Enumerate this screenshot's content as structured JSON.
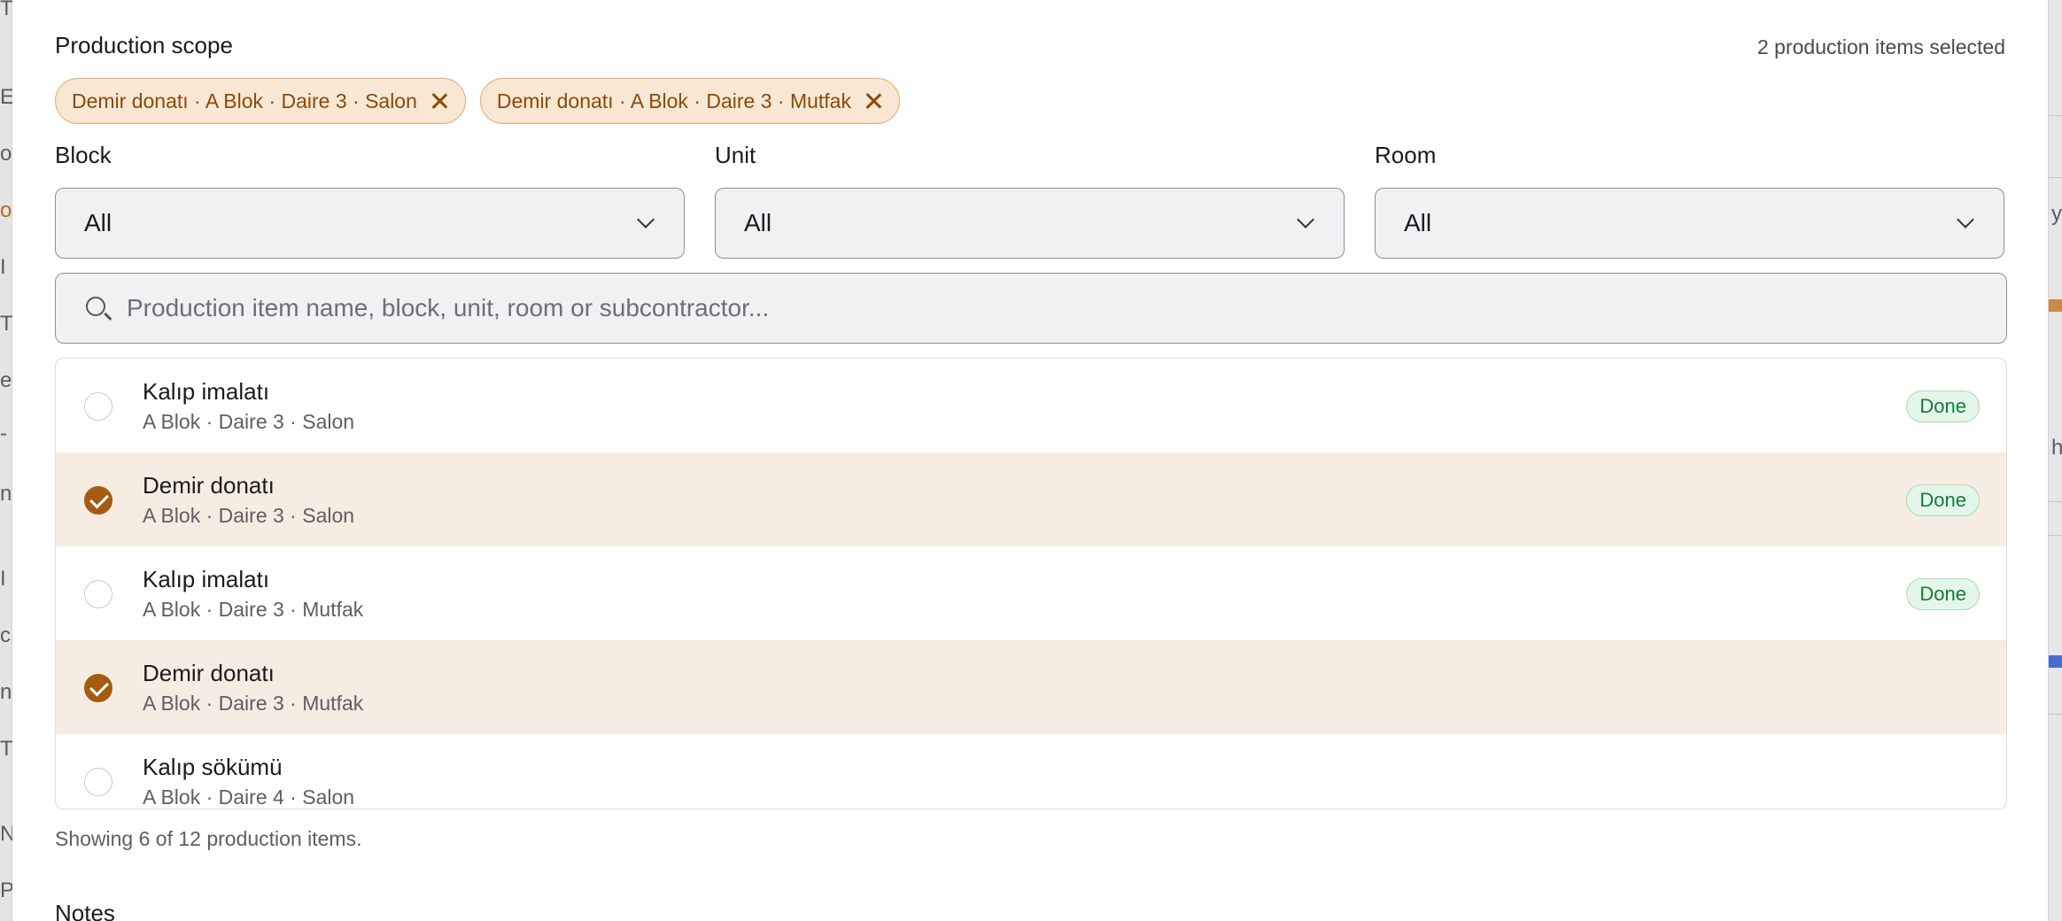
{
  "background": {
    "left_fragments": [
      "TI",
      "E",
      "or",
      "or",
      "I",
      "T",
      "et",
      "-",
      "nt",
      "I",
      "c",
      "n",
      "T",
      "N",
      "P"
    ],
    "right_fragments": [
      "y",
      "hi"
    ]
  },
  "production_scope": {
    "label": "Production scope",
    "selected_count_text": "2 production items selected",
    "chips": [
      {
        "label": "Demir donatı · A Blok · Daire 3 · Salon"
      },
      {
        "label": "Demir donatı · A Blok · Daire 3 · Mutfak"
      }
    ]
  },
  "filters": {
    "block": {
      "label": "Block",
      "value": "All"
    },
    "unit": {
      "label": "Unit",
      "value": "All"
    },
    "room": {
      "label": "Room",
      "value": "All"
    }
  },
  "search": {
    "placeholder": "Production item name, block, unit, room or subcontractor...",
    "value": ""
  },
  "items": [
    {
      "title": "Kalıp imalatı",
      "location": "A Blok · Daire 3 · Salon",
      "status": "Done",
      "selected": false
    },
    {
      "title": "Demir donatı",
      "location": "A Blok · Daire 3 · Salon",
      "status": "Done",
      "selected": true
    },
    {
      "title": "Kalıp imalatı",
      "location": "A Blok · Daire 3 · Mutfak",
      "status": "Done",
      "selected": false
    },
    {
      "title": "Demir donatı",
      "location": "A Blok · Daire 3 · Mutfak",
      "status": "",
      "selected": true
    },
    {
      "title": "Kalıp sökümü",
      "location": "A Blok · Daire 4 · Salon",
      "status": "",
      "selected": false
    }
  ],
  "showing_text": "Showing 6 of 12 production items.",
  "notes_label": "Notes",
  "colors": {
    "accent": "#a35c10",
    "chip_bg": "#f7e7d3",
    "selected_row_bg": "#f7ece1",
    "done_badge": "#177a3a"
  }
}
